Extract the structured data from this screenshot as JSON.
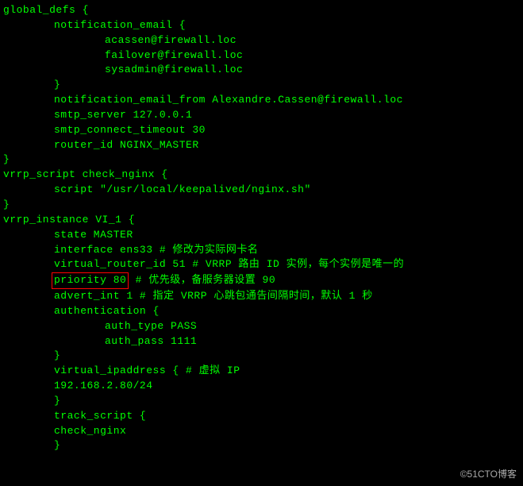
{
  "lines": {
    "l01": "global_defs {",
    "l02": "notification_email {",
    "l03": "acassen@firewall.loc",
    "l04": "failover@firewall.loc",
    "l05": "sysadmin@firewall.loc",
    "l06": "}",
    "l07": "notification_email_from Alexandre.Cassen@firewall.loc",
    "l08": "smtp_server 127.0.0.1",
    "l09": "smtp_connect_timeout 30",
    "l10": "router_id NGINX_MASTER",
    "l11": "}",
    "l12": "vrrp_script check_nginx {",
    "l13": "script \"/usr/local/keepalived/nginx.sh\"",
    "l14": "}",
    "l15": "vrrp_instance VI_1 {",
    "l16": "state MASTER",
    "l17": "interface ens33 # 修改为实际网卡名",
    "l18": "virtual_router_id 51 # VRRP 路由 ID 实例，每个实例是唯一的",
    "l19a": "priority 80",
    "l19b": " # 优先级，备服务器设置 90",
    "l20": "advert_int 1 # 指定 VRRP 心跳包通告间隔时间，默认 1 秒",
    "l21": "authentication {",
    "l22": "auth_type PASS",
    "l23": "auth_pass 1111",
    "l24": "}",
    "l25": "",
    "l26": "virtual_ipaddress { # 虚拟 IP",
    "l27": "192.168.2.80/24",
    "l28": "}",
    "l29": "track_script {",
    "l30": "check_nginx",
    "l31": "}"
  },
  "watermark": "©51CTO博客"
}
